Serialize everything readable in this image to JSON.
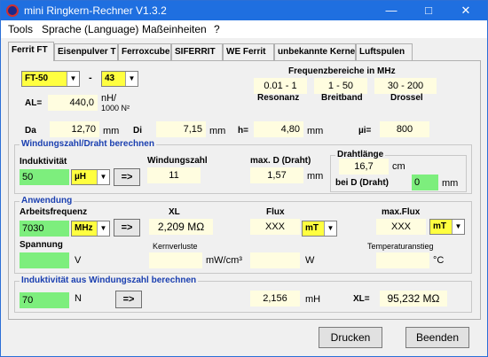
{
  "window": {
    "title": "mini Ringkern-Rechner V1.3.2"
  },
  "menu": [
    "Tools",
    "Sprache (Language)",
    "Maßeinheiten",
    "?"
  ],
  "tabs": [
    "Ferrit FT",
    "Eisenpulver T",
    "Ferroxcube",
    "SIFERRIT",
    "WE Ferrit",
    "unbekannte Kerne",
    "Luftspulen"
  ],
  "core": {
    "type": "FT-50",
    "dash": "-",
    "material": "43"
  },
  "freq": {
    "title": "Frequenzbereiche in MHz",
    "resonanz": "0.01 - 1",
    "breitband": "1 - 50",
    "drossel": "30 - 200",
    "lbl_res": "Resonanz",
    "lbl_breit": "Breitband",
    "lbl_dross": "Drossel"
  },
  "al": {
    "label": "AL=",
    "value": "440,0",
    "unit1": "nH/",
    "unit2": "1000 N²"
  },
  "dims": {
    "da_lbl": "Da",
    "da": "12,70",
    "di_lbl": "Di",
    "di": "7,15",
    "h_lbl": "h=",
    "h": "4,80",
    "mm": "mm",
    "mui_lbl": "µi=",
    "mui": "800"
  },
  "wind": {
    "title": "Windungszahl/Draht berechnen",
    "ind_lbl": "Induktivität",
    "ind": "50",
    "ind_unit": "µH",
    "wz_lbl": "Windungszahl",
    "wz": "11",
    "maxd_lbl": "max. D (Draht)",
    "maxd": "1,57",
    "mm": "mm",
    "dl_title": "Drahtlänge",
    "dl": "16,7",
    "cm": "cm",
    "beid_lbl": "bei D (Draht)",
    "beid": "0",
    "arrow": "=>"
  },
  "anw": {
    "title": "Anwendung",
    "af_lbl": "Arbeitsfrequenz",
    "af": "7030",
    "af_unit": "MHz",
    "arrow": "=>",
    "xl_lbl": "XL",
    "xl": "2,209 MΩ",
    "flux_lbl": "Flux",
    "flux": "XXX",
    "flux_unit": "mT",
    "mflux_lbl": "max.Flux",
    "mflux": "XXX",
    "mflux_unit": "mT",
    "sp_lbl": "Spannung",
    "sp_unit": "V",
    "kv_lbl": "Kernverluste",
    "kv_unit": "mW/cm³",
    "w_unit": "W",
    "ta_lbl": "Temperaturanstieg",
    "ta_unit": "°C"
  },
  "ind2": {
    "title": "Induktivität aus Windungszahl berechnen",
    "n": "70",
    "n_unit": "N",
    "result": "2,156",
    "mh": "mH",
    "xl_lbl": "XL=",
    "xl": "95,232 MΩ"
  },
  "buttons": {
    "print": "Drucken",
    "quit": "Beenden"
  }
}
